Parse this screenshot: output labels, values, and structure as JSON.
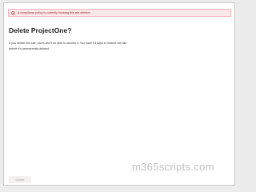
{
  "banner": {
    "message": "A compliance policy is currently blocking this site deletion.",
    "icon": "error-circle-icon",
    "color": "#a4262c"
  },
  "dialog": {
    "title": "Delete ProjectOne?",
    "body_line1": "If you delete this site, users won't be able to access it. You have 93 days to restore the site",
    "body_line2": "before it's permanently deleted.",
    "delete_label": "Delete"
  },
  "watermark": {
    "text": "m365scripts.com"
  }
}
